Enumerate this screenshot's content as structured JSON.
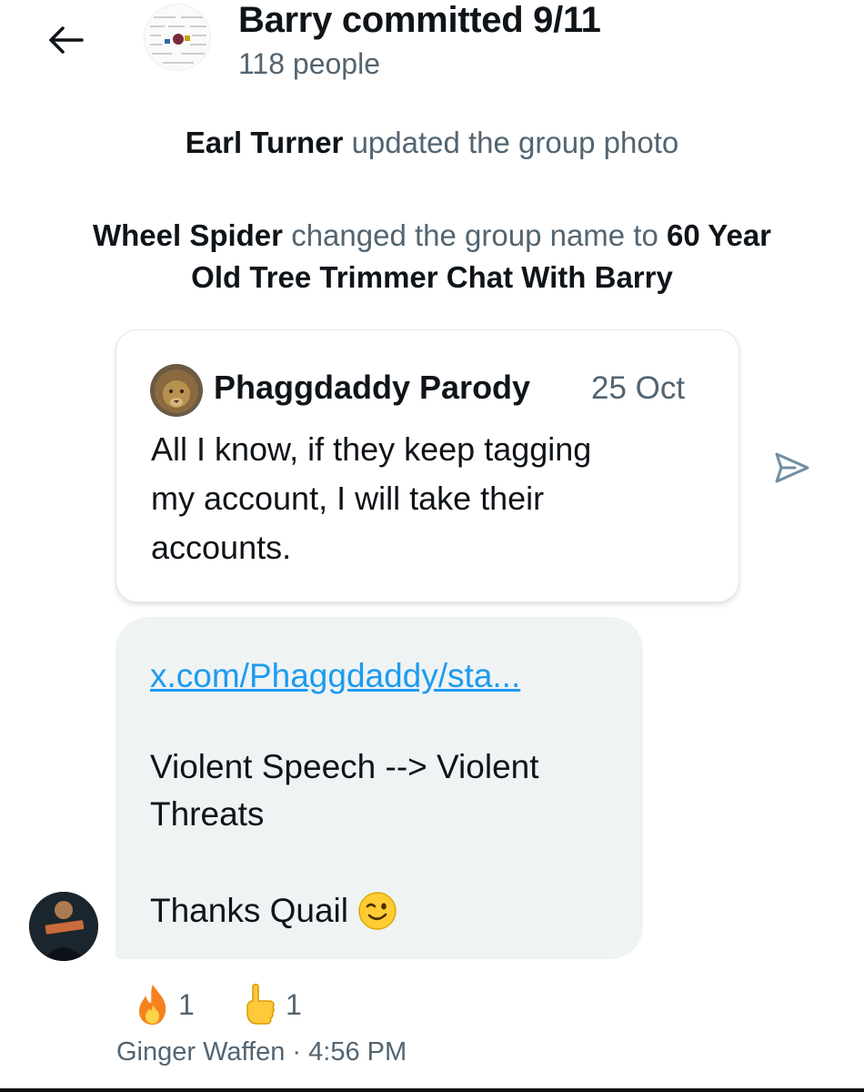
{
  "header": {
    "back_icon": "arrow-left-icon",
    "title": "Barry committed 9/11",
    "members": "118 people"
  },
  "notices": [
    {
      "actor": "Earl Turner",
      "action": "updated the group photo"
    },
    {
      "actor": "Wheel Spider",
      "action": "changed the group name to",
      "new_name_line1": "60 Year",
      "new_name_line2": "Old Tree Trimmer Chat With Barry"
    }
  ],
  "quote": {
    "author": "Phaggdaddy Parody",
    "date": "25 Oct",
    "lines": [
      "All I know, if they keep tagging",
      "my account, I will take their",
      "accounts."
    ],
    "share_icon": "share-arrow-icon"
  },
  "message": {
    "link": "x.com/Phaggdaddy/sta...",
    "line1": "Violent Speech --> Violent",
    "line2": "Threats",
    "line3": "Thanks Quail",
    "emoji": "winking-face-emoji"
  },
  "reactions": [
    {
      "icon": "fire-icon",
      "count": "1"
    },
    {
      "icon": "pointing-up-icon",
      "count": "1"
    }
  ],
  "meta": {
    "sender_time": "Ginger Waffen · 4:56 PM"
  },
  "colors": {
    "accent": "#1d9bf0",
    "text": "#0f1419",
    "secondary": "#536471",
    "bubble": "#eff3f4"
  }
}
